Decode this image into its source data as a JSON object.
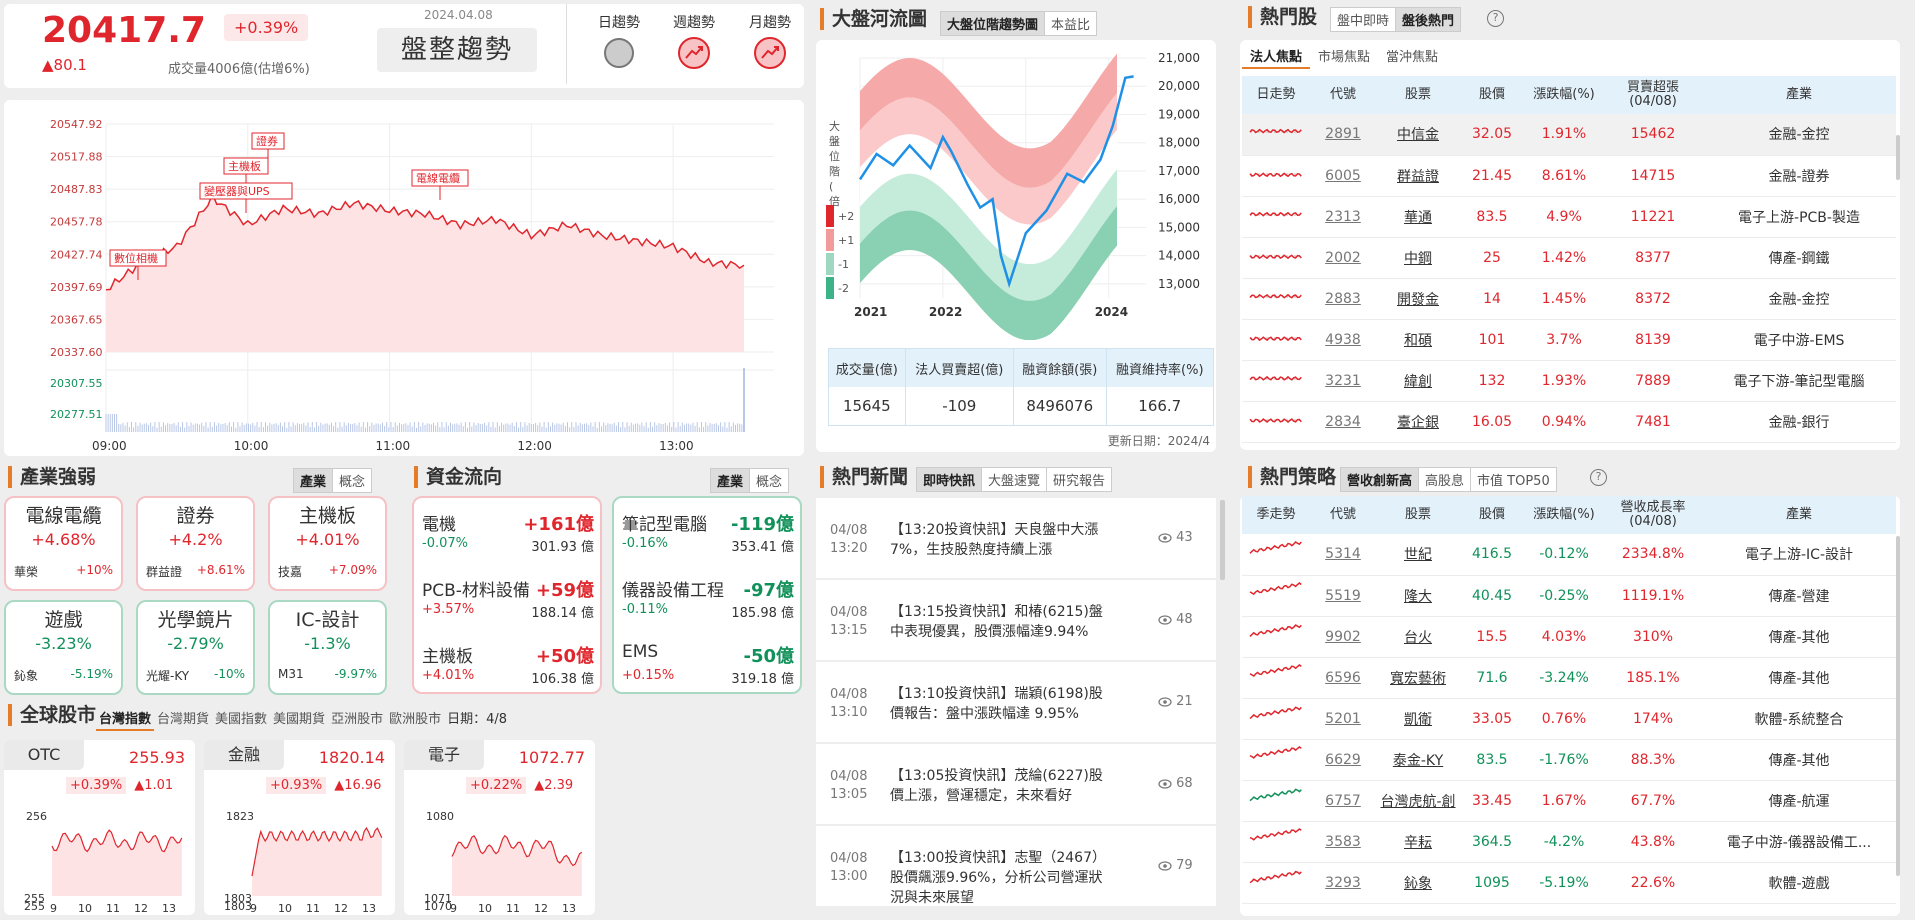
{
  "top": {
    "index": "20417.7",
    "pct": "+0.39%",
    "change": "▲80.1",
    "volume": "成交量4006億(估增6%)",
    "date": "2024.04.08",
    "trend": "盤整趨勢",
    "trend_labels": [
      "日趨勢",
      "週趨勢",
      "月趨勢"
    ]
  },
  "intraday": {
    "y_ticks": [
      "20547.92",
      "20517.88",
      "20487.83",
      "20457.78",
      "20427.74",
      "20397.69",
      "20367.65",
      "20337.60"
    ],
    "vol_ticks": [
      "20307.55",
      "20277.51"
    ],
    "x_ticks": [
      "09:00",
      "10:00",
      "11:00",
      "12:00",
      "13:00"
    ],
    "tags": [
      "證券",
      "主機板",
      "變壓器與UPS",
      "電線電纜",
      "數位相機"
    ],
    "chart_data": {
      "type": "area",
      "x": [
        "09:00",
        "09:15",
        "09:30",
        "09:45",
        "10:00",
        "10:15",
        "10:30",
        "10:45",
        "11:00",
        "11:15",
        "11:30",
        "11:45",
        "12:00",
        "12:15",
        "12:30",
        "12:45",
        "13:00",
        "13:15",
        "13:30"
      ],
      "y": [
        20395,
        20420,
        20435,
        20480,
        20455,
        20470,
        20465,
        20475,
        20468,
        20465,
        20455,
        20460,
        20445,
        20455,
        20445,
        20440,
        20435,
        20420,
        20417.7
      ],
      "ylim": [
        20337.6,
        20547.92
      ]
    }
  },
  "river": {
    "title": "大盤河流圖",
    "tabs": [
      "大盤位階趨勢圖",
      "本益比"
    ],
    "vlabel": "大盤位階(倍)",
    "legend": [
      "+2",
      "+1",
      "-1",
      "-2"
    ],
    "y_ticks": [
      "21,000",
      "20,000",
      "19,000",
      "18,000",
      "17,000",
      "16,000",
      "15,000",
      "14,000",
      "13,000"
    ],
    "x_ticks": [
      "2021",
      "2022",
      "2023",
      "2024"
    ],
    "stats_head": [
      "成交量(億)",
      "法人買賣超(億)",
      "融資餘額(張)",
      "融資維持率(%)"
    ],
    "stats_vals": [
      "15645",
      "-109",
      "8496076",
      "166.7"
    ],
    "updated": "更新日期：2024/4",
    "chart_data": {
      "type": "line",
      "x": [
        "2021.0",
        "2021.5",
        "2022.0",
        "2022.5",
        "2022.8",
        "2023.0",
        "2023.5",
        "2023.9",
        "2024.2"
      ],
      "y": [
        16700,
        17500,
        17200,
        15800,
        13000,
        14800,
        16800,
        17500,
        20300
      ],
      "ylim": [
        12500,
        21000
      ]
    }
  },
  "hot": {
    "title": "熱門股",
    "tabs": [
      "盤中即時",
      "盤後熱門"
    ],
    "subtabs": [
      "法人焦點",
      "市場焦點",
      "當沖焦點"
    ],
    "head": [
      "日走勢",
      "代號",
      "股票",
      "股價",
      "漲跌幅(%)",
      "買賣超張 (04/08)",
      "產業"
    ],
    "rows": [
      [
        "2891",
        "中信金",
        "32.05",
        "1.91%",
        "15462",
        "金融-金控"
      ],
      [
        "6005",
        "群益證",
        "21.45",
        "8.61%",
        "14715",
        "金融-證券"
      ],
      [
        "2313",
        "華通",
        "83.5",
        "4.9%",
        "11221",
        "電子上游-PCB-製造"
      ],
      [
        "2002",
        "中鋼",
        "25",
        "1.42%",
        "8377",
        "傳產-鋼鐵"
      ],
      [
        "2883",
        "開發金",
        "14",
        "1.45%",
        "8372",
        "金融-金控"
      ],
      [
        "4938",
        "和碩",
        "101",
        "3.7%",
        "8139",
        "電子中游-EMS"
      ],
      [
        "3231",
        "緯創",
        "132",
        "1.93%",
        "7889",
        "電子下游-筆記型電腦"
      ],
      [
        "2834",
        "臺企銀",
        "16.05",
        "0.94%",
        "7481",
        "金融-銀行"
      ]
    ]
  },
  "industry": {
    "title": "產業強弱",
    "tabs": [
      "產業",
      "概念"
    ],
    "cards": [
      {
        "name": "電線電纜",
        "pct": "+4.68%",
        "stock": "華榮",
        "spct": "+10%"
      },
      {
        "name": "證券",
        "pct": "+4.2%",
        "stock": "群益證",
        "spct": "+8.61%"
      },
      {
        "name": "主機板",
        "pct": "+4.01%",
        "stock": "技嘉",
        "spct": "+7.09%"
      },
      {
        "name": "遊戲",
        "pct": "-3.23%",
        "stock": "鈊象",
        "spct": "-5.19%"
      },
      {
        "name": "光學鏡片",
        "pct": "-2.79%",
        "stock": "光耀-KY",
        "spct": "-10%"
      },
      {
        "name": "IC-設計",
        "pct": "-1.3%",
        "stock": "M31",
        "spct": "-9.97%"
      }
    ]
  },
  "flow": {
    "title": "資金流向",
    "tabs": [
      "產業",
      "概念"
    ],
    "left": [
      {
        "name": "電機",
        "val": "+161億",
        "pct": "-0.07%",
        "amt": "301.93 億"
      },
      {
        "name": "PCB-材料設備",
        "val": "+59億",
        "pct": "+3.57%",
        "amt": "188.14 億"
      },
      {
        "name": "主機板",
        "val": "+50億",
        "pct": "+4.01%",
        "amt": "106.38 億"
      }
    ],
    "right": [
      {
        "name": "筆記型電腦",
        "val": "-119億",
        "pct": "-0.16%",
        "amt": "353.41 億"
      },
      {
        "name": "儀器設備工程",
        "val": "-97億",
        "pct": "-0.11%",
        "amt": "185.98 億"
      },
      {
        "name": "EMS",
        "val": "-50億",
        "pct": "+0.15%",
        "amt": "319.18 億"
      }
    ]
  },
  "news": {
    "title": "熱門新聞",
    "tabs": [
      "即時快訊",
      "大盤速覽",
      "研究報告"
    ],
    "items": [
      {
        "date": "04/08",
        "time": "13:20",
        "text": "【13:20投資快訊】天良盤中大漲7%，生技股熱度持續上漲",
        "views": "43"
      },
      {
        "date": "04/08",
        "time": "13:15",
        "text": "【13:15投資快訊】和椿(6215)盤中表現優異，股價漲幅達9.94%",
        "views": "48"
      },
      {
        "date": "04/08",
        "time": "13:10",
        "text": "【13:10投資快訊】瑞穎(6198)股價報告：盤中漲跌幅達 9.95%",
        "views": "21"
      },
      {
        "date": "04/08",
        "time": "13:05",
        "text": "【13:05投資快訊】茂綸(6227)股價上漲，營運穩定，未來看好",
        "views": "68"
      },
      {
        "date": "04/08",
        "time": "13:00",
        "text": "【13:00投資快訊】志聖（2467）股價飆漲9.96%，分析公司營運狀況與未來展望",
        "views": "79"
      }
    ]
  },
  "strategy": {
    "title": "熱門策略",
    "tabs": [
      "營收創新高",
      "高股息",
      "市值 TOP50"
    ],
    "head": [
      "季走勢",
      "代號",
      "股票",
      "股價",
      "漲跌幅(%)",
      "營收成長率 (04/08)",
      "產業"
    ],
    "rows": [
      [
        "5314",
        "世紀",
        "416.5",
        "-0.12%",
        "2334.8%",
        "電子上游-IC-設計"
      ],
      [
        "5519",
        "隆大",
        "40.45",
        "-0.25%",
        "1119.1%",
        "傳產-營建"
      ],
      [
        "9902",
        "台火",
        "15.5",
        "4.03%",
        "310%",
        "傳產-其他"
      ],
      [
        "6596",
        "寬宏藝術",
        "71.6",
        "-3.24%",
        "185.1%",
        "傳產-其他"
      ],
      [
        "5201",
        "凱衛",
        "33.05",
        "0.76%",
        "174%",
        "軟體-系統整合"
      ],
      [
        "6629",
        "泰金-KY",
        "83.5",
        "-1.76%",
        "88.3%",
        "傳產-其他"
      ],
      [
        "6757",
        "台灣虎航-創",
        "33.45",
        "1.67%",
        "67.7%",
        "傳產-航運"
      ],
      [
        "3583",
        "辛耘",
        "364.5",
        "-4.2%",
        "43.8%",
        "電子中游-儀器設備工..."
      ],
      [
        "3293",
        "鈊象",
        "1095",
        "-5.19%",
        "22.6%",
        "軟體-遊戲"
      ]
    ]
  },
  "global": {
    "title": "全球股市",
    "tabs": [
      "台灣指數",
      "台灣期貨",
      "美國指數",
      "美國期貨",
      "亞洲股市",
      "歐洲股市"
    ],
    "date": "日期：4/8",
    "cards": [
      {
        "name": "OTC",
        "price": "255.93",
        "pct": "+0.39%",
        "chg": "▲1.01",
        "yt": "256",
        "yb": "255",
        "yb2": "255",
        "xt": [
          "9",
          "10",
          "11",
          "12",
          "13"
        ]
      },
      {
        "name": "金融",
        "price": "1820.14",
        "pct": "+0.93%",
        "chg": "▲16.96",
        "yt": "1823",
        "yb": "1803",
        "yb2": "1803",
        "xt": [
          "9",
          "10",
          "11",
          "12",
          "13"
        ]
      },
      {
        "name": "電子",
        "price": "1072.77",
        "pct": "+0.22%",
        "chg": "▲2.39",
        "yt": "1080",
        "yb": "1071",
        "yb2": "1070",
        "xt": [
          "9",
          "10",
          "11",
          "12",
          "13"
        ]
      }
    ]
  }
}
